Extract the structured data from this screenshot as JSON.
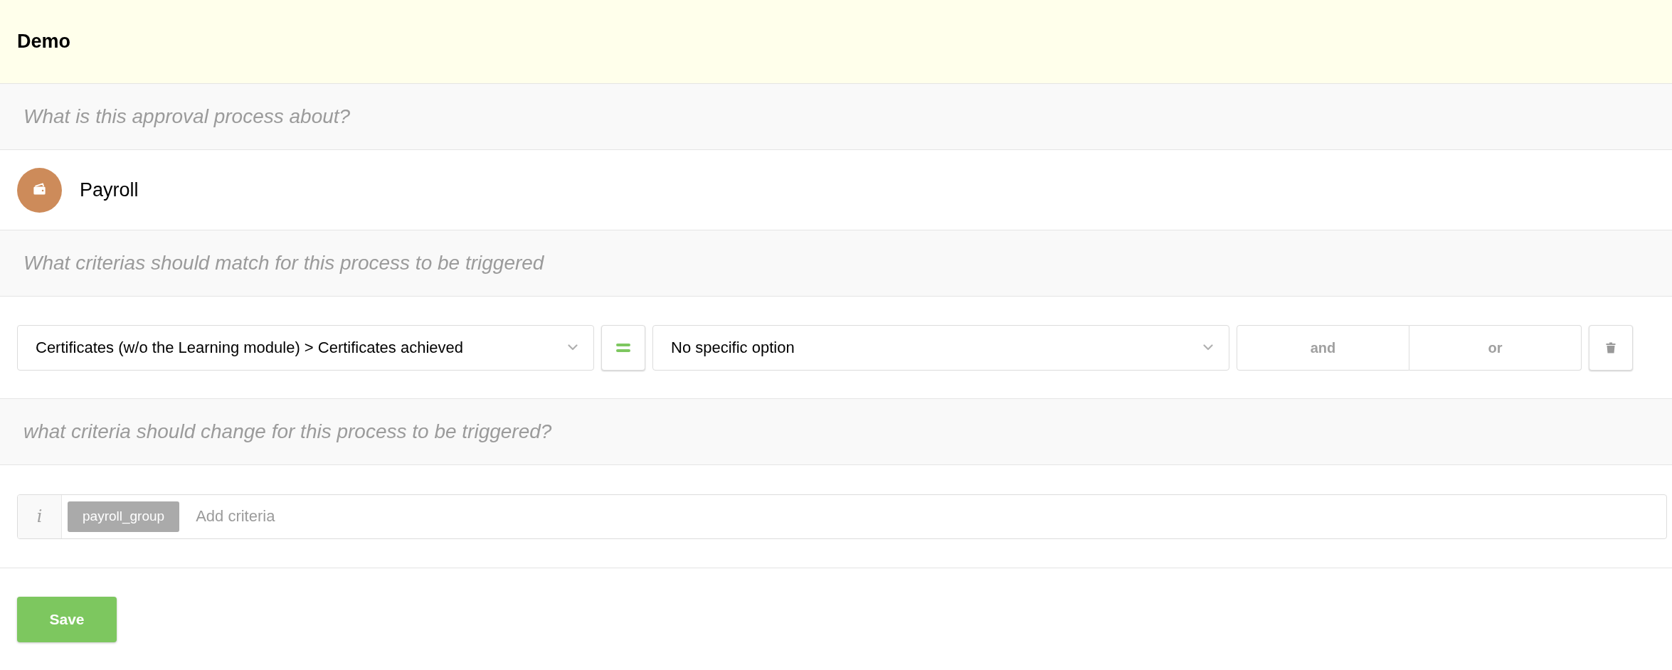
{
  "title": "Demo",
  "about_heading": "What is this approval process about?",
  "category": {
    "label": "Payroll"
  },
  "match_heading": "What criterias should match for this process to be triggered",
  "conditions": [
    {
      "field": "Certificates (w/o the Learning module) > Certificates achieved",
      "value": "No specific option",
      "connectors": [
        {
          "label": "and",
          "selected": false
        },
        {
          "label": "or",
          "selected": false
        }
      ]
    }
  ],
  "change_heading": "what criteria should change for this process to be triggered?",
  "change_criteria": {
    "info_glyph": "i",
    "tags": [
      "payroll_group"
    ],
    "placeholder": "Add criteria"
  },
  "save_button": "Save"
}
